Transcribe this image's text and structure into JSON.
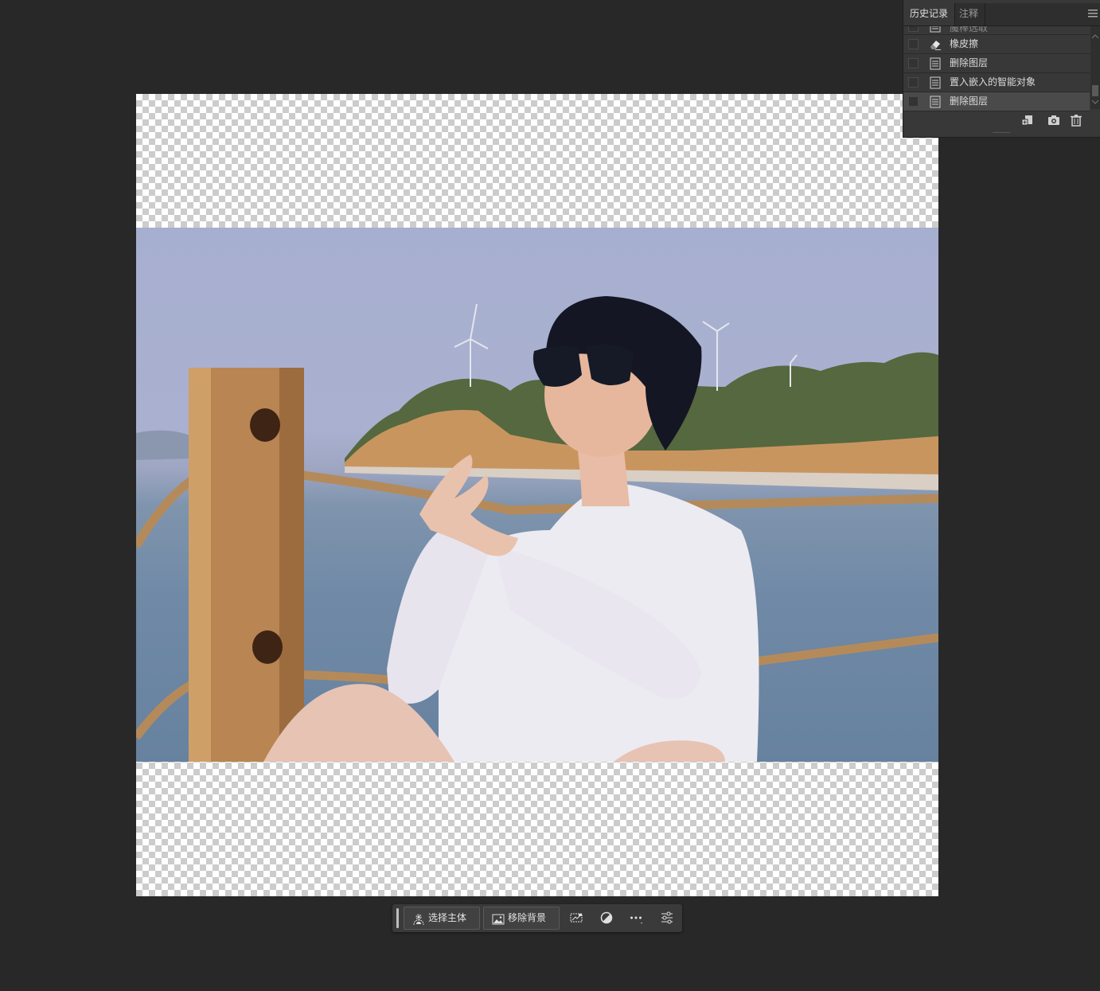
{
  "history_panel": {
    "tabs": [
      {
        "label": "历史记录",
        "active": true
      },
      {
        "label": "注释",
        "active": false
      }
    ],
    "menu_icon": "hamburger-menu-icon",
    "items": [
      {
        "label": "魔棒选取",
        "icon": "document-step-icon",
        "partial": true
      },
      {
        "label": "橡皮擦",
        "icon": "eraser-icon"
      },
      {
        "label": "删除图层",
        "icon": "document-step-icon"
      },
      {
        "label": "置入嵌入的智能对象",
        "icon": "document-step-icon"
      },
      {
        "label": "删除图层",
        "icon": "document-step-icon",
        "selected": true
      }
    ],
    "footer_icons": [
      "new-document-from-state-icon",
      "camera-snapshot-icon",
      "trash-icon"
    ]
  },
  "taskbar": {
    "select_subject_label": "选择主体",
    "remove_background_label": "移除背景",
    "icons": [
      "transform-icon",
      "adjustment-icon",
      "more-icon",
      "settings-sliders-icon"
    ]
  },
  "colors": {
    "app_background": "#282828",
    "panel_background": "#383838",
    "selected_row": "#4a4a4a"
  }
}
